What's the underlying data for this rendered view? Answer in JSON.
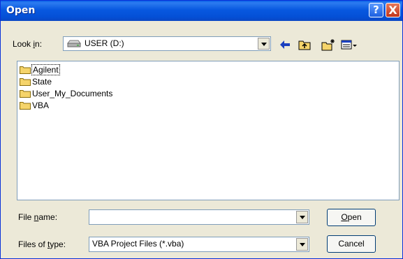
{
  "window": {
    "title": "Open",
    "help_symbol": "?",
    "close_symbol": "X"
  },
  "look_in": {
    "label_pre": "Look ",
    "label_key": "i",
    "label_post": "n:",
    "value": "USER (D:)",
    "drive_icon": "drive-icon"
  },
  "toolbar": {
    "back_icon": "back-arrow-icon",
    "up_icon": "up-folder-icon",
    "new_folder_icon": "new-folder-icon",
    "view_icon": "view-menu-icon"
  },
  "files": [
    {
      "name": "Agilent",
      "icon": "folder-icon"
    },
    {
      "name": "State",
      "icon": "folder-icon"
    },
    {
      "name": "User_My_Documents",
      "icon": "folder-icon"
    },
    {
      "name": "VBA",
      "icon": "folder-icon"
    }
  ],
  "file_name": {
    "label_pre": "File ",
    "label_key": "n",
    "label_post": "ame:",
    "value": ""
  },
  "file_type": {
    "label_pre": "Files of ",
    "label_key": "t",
    "label_post": "ype:",
    "value": "VBA Project Files (*.vba)"
  },
  "buttons": {
    "open_key": "O",
    "open_rest": "pen",
    "cancel": "Cancel"
  },
  "colors": {
    "titlebar": "#0a5fe8",
    "dialog_bg": "#ece9d8",
    "folder": "#f5d46b"
  }
}
